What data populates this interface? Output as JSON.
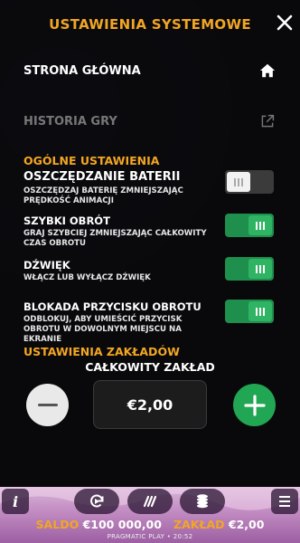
{
  "header": {
    "title": "USTAWIENIA SYSTEMOWE"
  },
  "links": {
    "home": "STRONA GŁÓWNA",
    "history": "HISTORIA GRY"
  },
  "general": {
    "title": "OGÓLNE USTAWIENIA",
    "settings": [
      {
        "title": "OSZCZĘDZANIE BATERII",
        "desc": "OSZCZĘDZAJ BATERIĘ ZMNIEJSZAJĄC PRĘDKOŚĆ ANIMACJI",
        "on": false
      },
      {
        "title": "SZYBKI OBRÓT",
        "desc": "GRAJ SZYBCIEJ ZMNIEJSZAJĄC CAŁKOWITY CZAS OBROTU",
        "on": true
      },
      {
        "title": "DŹWIĘK",
        "desc": "WŁĄCZ LUB WYŁĄCZ DŹWIĘK",
        "on": true
      },
      {
        "title": "BLOKADA PRZYCISKU OBROTU",
        "desc": "ODBLOKUJ, ABY UMIEŚCIĆ PRZYCISK OBROTU W DOWOLNYM MIEJSCU NA EKRANIE",
        "on": true
      }
    ]
  },
  "bets": {
    "title": "USTAWIENIA ZAKŁADÓW",
    "total_label": "CAŁKOWITY ZAKŁAD",
    "stake": "€2,00"
  },
  "bottom": {
    "info_label": "i",
    "balance_label": "SALDO",
    "balance_value": "€100 000,00",
    "bet_label": "ZAKŁAD",
    "bet_value": "€2,00",
    "footer": "PRAGMATIC PLAY • 20:52"
  },
  "colors": {
    "accent": "#f2a623",
    "toggle_on": "#2fb463",
    "plus": "#21a653"
  }
}
